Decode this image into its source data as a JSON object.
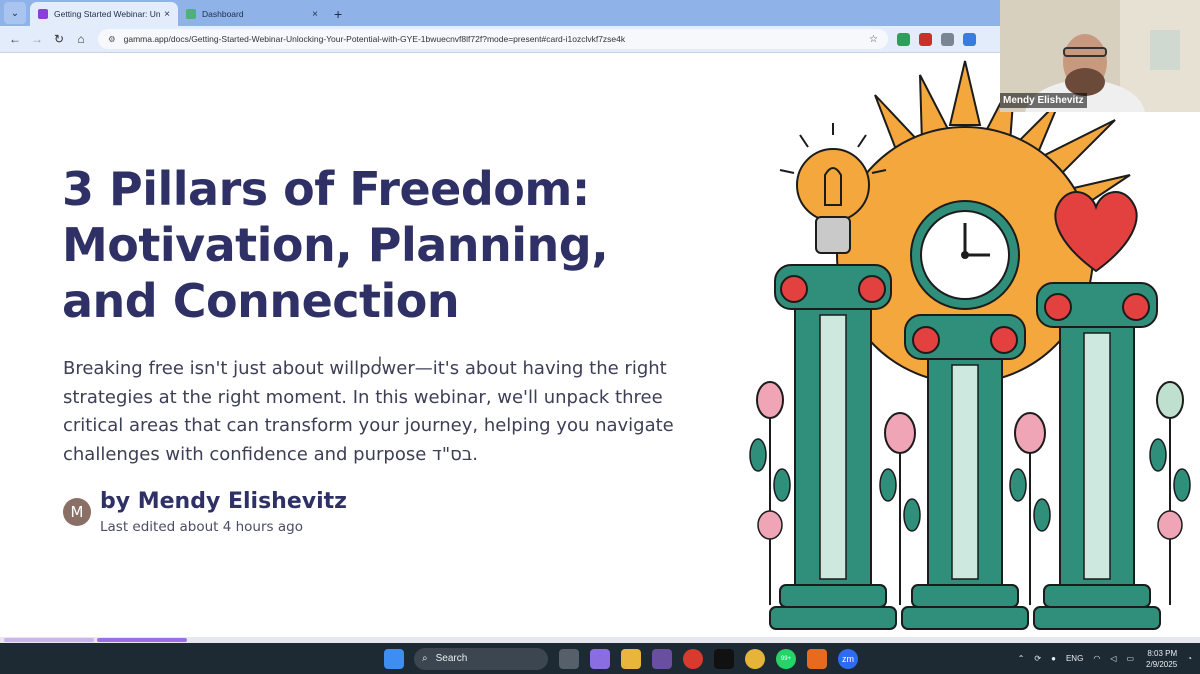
{
  "browser": {
    "tabs": [
      {
        "title": "Getting Started Webinar: Unloc",
        "active": true,
        "favicon_color": "#8b3fd9"
      },
      {
        "title": "Dashboard",
        "active": false,
        "favicon_color": "#4fb07a"
      }
    ],
    "url": "gamma.app/docs/Getting-Started-Webinar-Unlocking-Your-Potential-with-GYE-1bwuecnvf8lf72f?mode=present#card-i1ozclvkf7zse4k",
    "new_tab_glyph": "+",
    "close_glyph": "×"
  },
  "slide": {
    "heading_line1": "3 Pillars of Freedom:",
    "heading_line2": "Motivation, Planning,",
    "heading_line3": "and Connection",
    "body": "Breaking free isn't just about willpower—it's about having the right strategies at the right moment. In this webinar, we'll unpack three critical areas that can transform your journey, helping you navigate challenges with confidence and purpose בס\"ד.",
    "avatar_initial": "M",
    "author": "by Mendy Elishevitz",
    "edited": "Last edited about 4 hours ago"
  },
  "video": {
    "participant_name": "Mendy Elishevitz"
  },
  "taskbar": {
    "search_label": "Search",
    "language": "ENG",
    "time": "8:03 PM",
    "date": "2/9/2025",
    "whatsapp_badge": "99+"
  },
  "colors": {
    "heading": "#2f3166",
    "progress_done": "#9b6ee6",
    "tabstrip": "#8fb3e8"
  }
}
